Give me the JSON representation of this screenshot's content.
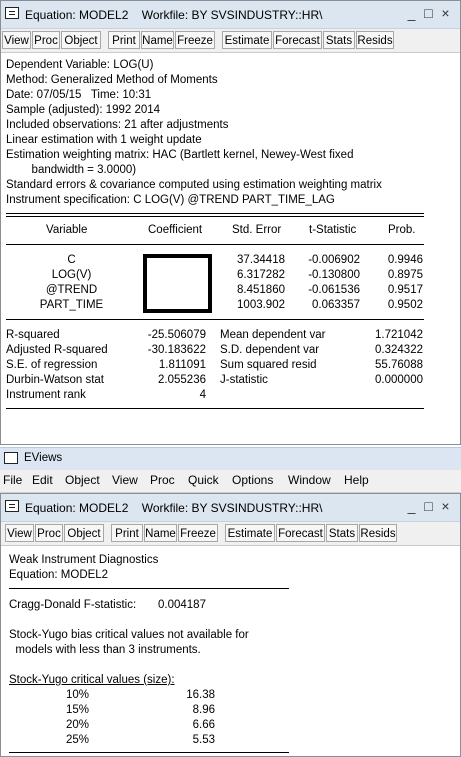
{
  "window1": {
    "title": "Equation: MODEL2    Workfile: BY SVSINDUSTRY::HR\\",
    "controls": [
      "_",
      "□",
      "×"
    ],
    "toolbar": [
      "View",
      "Proc",
      "Object",
      "Print",
      "Name",
      "Freeze",
      "Estimate",
      "Forecast",
      "Stats",
      "Resids"
    ],
    "header_lines": [
      "Dependent Variable: LOG(U)",
      "Method: Generalized Method of Moments",
      "Date: 07/05/15   Time: 10:31",
      "Sample (adjusted): 1992 2014",
      "Included observations: 21 after adjustments",
      "Linear estimation with 1 weight update",
      "Estimation weighting matrix: HAC (Bartlett kernel, Newey-West fixed",
      "        bandwidth = 3.0000)",
      "Standard errors & covariance computed using estimation weighting matrix",
      "Instrument specification: C LOG(V) @TREND PART_TIME_LAG"
    ],
    "table_headers": [
      "Variable",
      "Coefficient",
      "Std. Error",
      "t-Statistic",
      "Prob."
    ],
    "table_rows": [
      {
        "variable": "C",
        "std_error": "37.34418",
        "t_stat": "-0.006902",
        "prob": "0.9946"
      },
      {
        "variable": "LOG(V)",
        "std_error": "6.317282",
        "t_stat": "-0.130800",
        "prob": "0.8975"
      },
      {
        "variable": "@TREND",
        "std_error": "8.451860",
        "t_stat": "-0.061536",
        "prob": "0.9517"
      },
      {
        "variable": "PART_TIME",
        "std_error": "1003.902",
        "t_stat": "0.063357",
        "prob": "0.9502"
      }
    ],
    "stats": [
      {
        "label": "R-squared",
        "value": "-25.506079",
        "label2": "Mean dependent var",
        "value2": "1.721042"
      },
      {
        "label": "Adjusted R-squared",
        "value": "-30.183622",
        "label2": "S.D. dependent var",
        "value2": "0.324322"
      },
      {
        "label": "S.E. of regression",
        "value": "1.811091",
        "label2": "Sum squared resid",
        "value2": "55.76088"
      },
      {
        "label": "Durbin-Watson stat",
        "value": "2.055236",
        "label2": "J-statistic",
        "value2": "0.000000"
      },
      {
        "label": "Instrument rank",
        "value": "4",
        "label2": "",
        "value2": ""
      }
    ]
  },
  "app": {
    "title": "EViews",
    "menu": [
      "File",
      "Edit",
      "Object",
      "View",
      "Proc",
      "Quick",
      "Options",
      "Window",
      "Help"
    ]
  },
  "window2": {
    "title": "Equation: MODEL2    Workfile: BY SVSINDUSTRY::HR\\",
    "controls": [
      "_",
      "□",
      "×"
    ],
    "toolbar": [
      "View",
      "Proc",
      "Object",
      "Print",
      "Name",
      "Freeze",
      "Estimate",
      "Forecast",
      "Stats",
      "Resids"
    ],
    "lines": [
      "Weak Instrument Diagnostics",
      "Equation: MODEL2"
    ],
    "cragg_label": "Cragg-Donald F-statistic:",
    "cragg_value": "0.004187",
    "note_lines": [
      "Stock-Yugo bias critical values not available for",
      "  models with less than 3 instruments."
    ],
    "crit_header": "Stock-Yugo critical values (size):",
    "crit_rows": [
      {
        "size": "10%",
        "value": "16.38"
      },
      {
        "size": "15%",
        "value": "8.96"
      },
      {
        "size": "20%",
        "value": "6.66"
      },
      {
        "size": "25%",
        "value": "5.53"
      }
    ]
  }
}
